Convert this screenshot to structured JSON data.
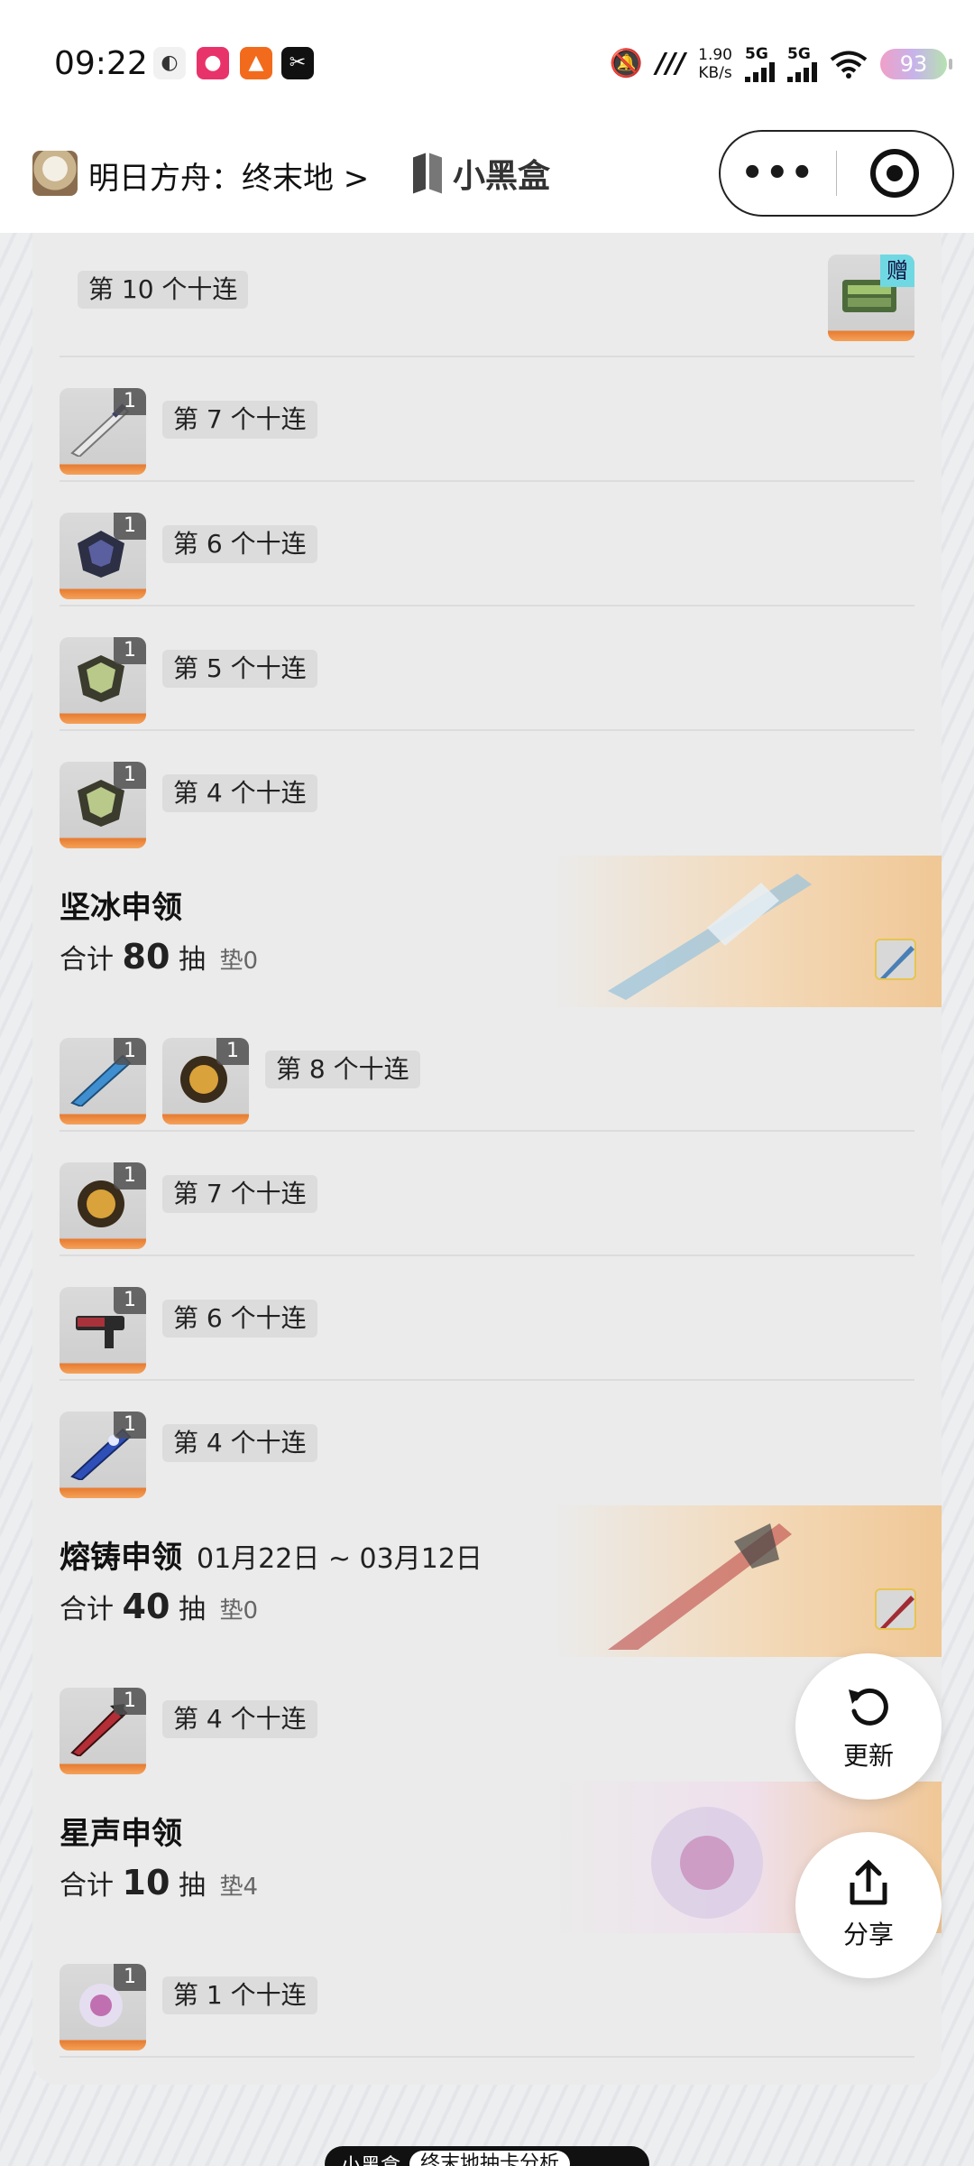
{
  "status_bar": {
    "time": "09:22",
    "speed_value": "1.90",
    "speed_unit": "KB/s",
    "net1": "5G",
    "net2": "5G",
    "battery": "93"
  },
  "title_bar": {
    "app_title": "明日方舟：终末地 >",
    "brand": "小黑盒",
    "more_label": "•••"
  },
  "pulls": {
    "group1": {
      "top_row": {
        "label": "第 10 个十连",
        "gift": "赠"
      },
      "rows": [
        {
          "count": "1",
          "label": "第 7 个十连",
          "icon": "sword-icon"
        },
        {
          "count": "1",
          "label": "第 6 个十连",
          "icon": "dark-armor-icon"
        },
        {
          "count": "1",
          "label": "第 5 个十连",
          "icon": "green-armor-icon"
        },
        {
          "count": "1",
          "label": "第 4 个十连",
          "icon": "green-armor-icon"
        }
      ]
    },
    "banner1": {
      "name": "坚冰申领",
      "dates": "",
      "total_prefix": "合计",
      "total": "80",
      "total_suffix": "抽",
      "pity": "垫0"
    },
    "group2": {
      "rows": [
        {
          "counts": [
            "1",
            "1"
          ],
          "label": "第 8 个十连"
        },
        {
          "count": "1",
          "label": "第 7 个十连"
        },
        {
          "count": "1",
          "label": "第 6 个十连"
        },
        {
          "count": "1",
          "label": "第 4 个十连"
        }
      ]
    },
    "banner2": {
      "name": "熔铸申领",
      "dates": "01月22日 ~ 03月12日",
      "total_prefix": "合计",
      "total": "40",
      "total_suffix": "抽",
      "pity": "垫0"
    },
    "group3": {
      "rows": [
        {
          "count": "1",
          "label": "第 4 个十连"
        }
      ]
    },
    "banner3": {
      "name": "星声申领",
      "dates": "",
      "total_prefix": "合计",
      "total": "10",
      "total_suffix": "抽",
      "pity": "垫4"
    },
    "group4": {
      "rows": [
        {
          "count": "1",
          "label": "第 1 个十连"
        }
      ]
    }
  },
  "actions": {
    "refresh_label": "更新",
    "share_label": "分享"
  },
  "footer": {
    "brand": "小黑盒",
    "text": "终末地抽卡分析"
  }
}
